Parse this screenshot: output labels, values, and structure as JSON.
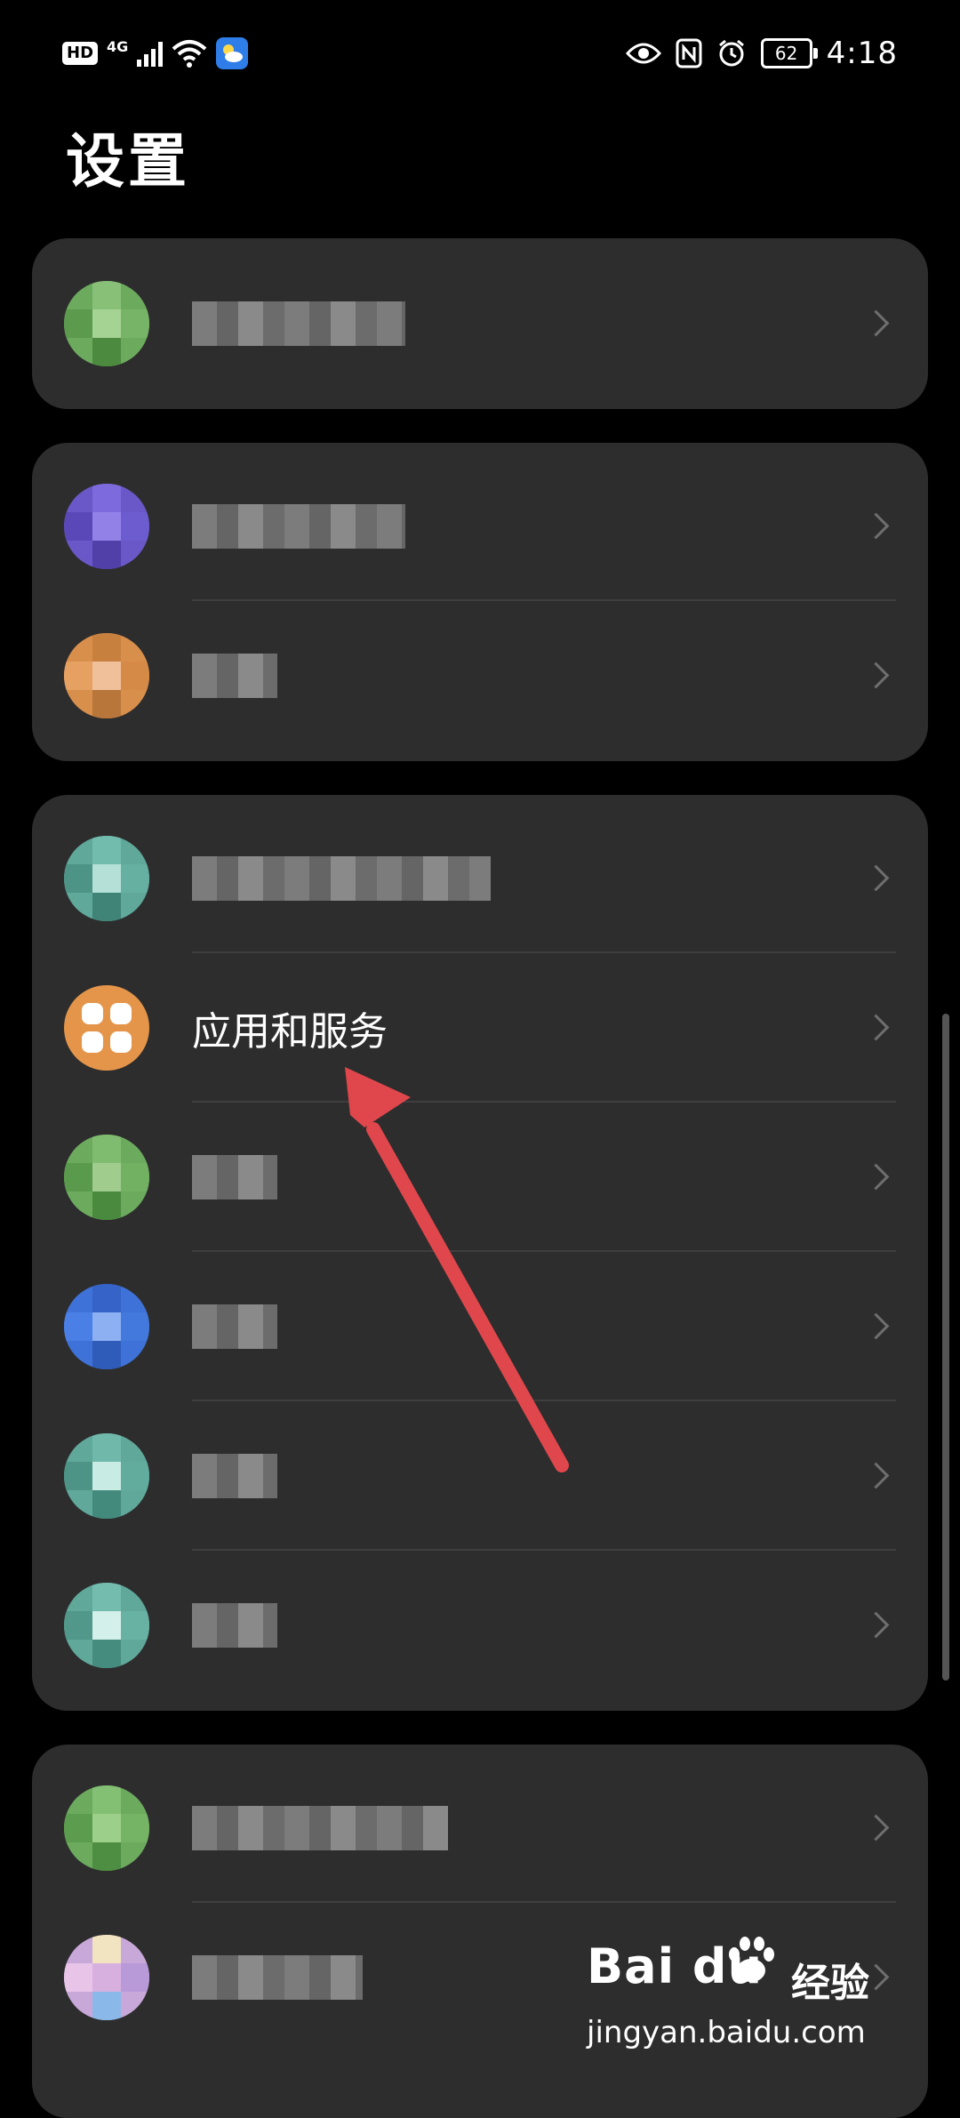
{
  "status_bar": {
    "hd": "HD",
    "network": "4G",
    "battery": "62",
    "time": "4:18"
  },
  "page": {
    "title": "设置"
  },
  "settings": {
    "apps_label": "应用和服务"
  },
  "watermark": {
    "brand_logo": "Bai du",
    "brand_name": "经验",
    "url": "jingyan.baidu.com"
  },
  "colors": {
    "background": "#000000",
    "card": "#2d2d2d",
    "apps_icon": "#e4954a",
    "arrow": "#e0474c"
  }
}
